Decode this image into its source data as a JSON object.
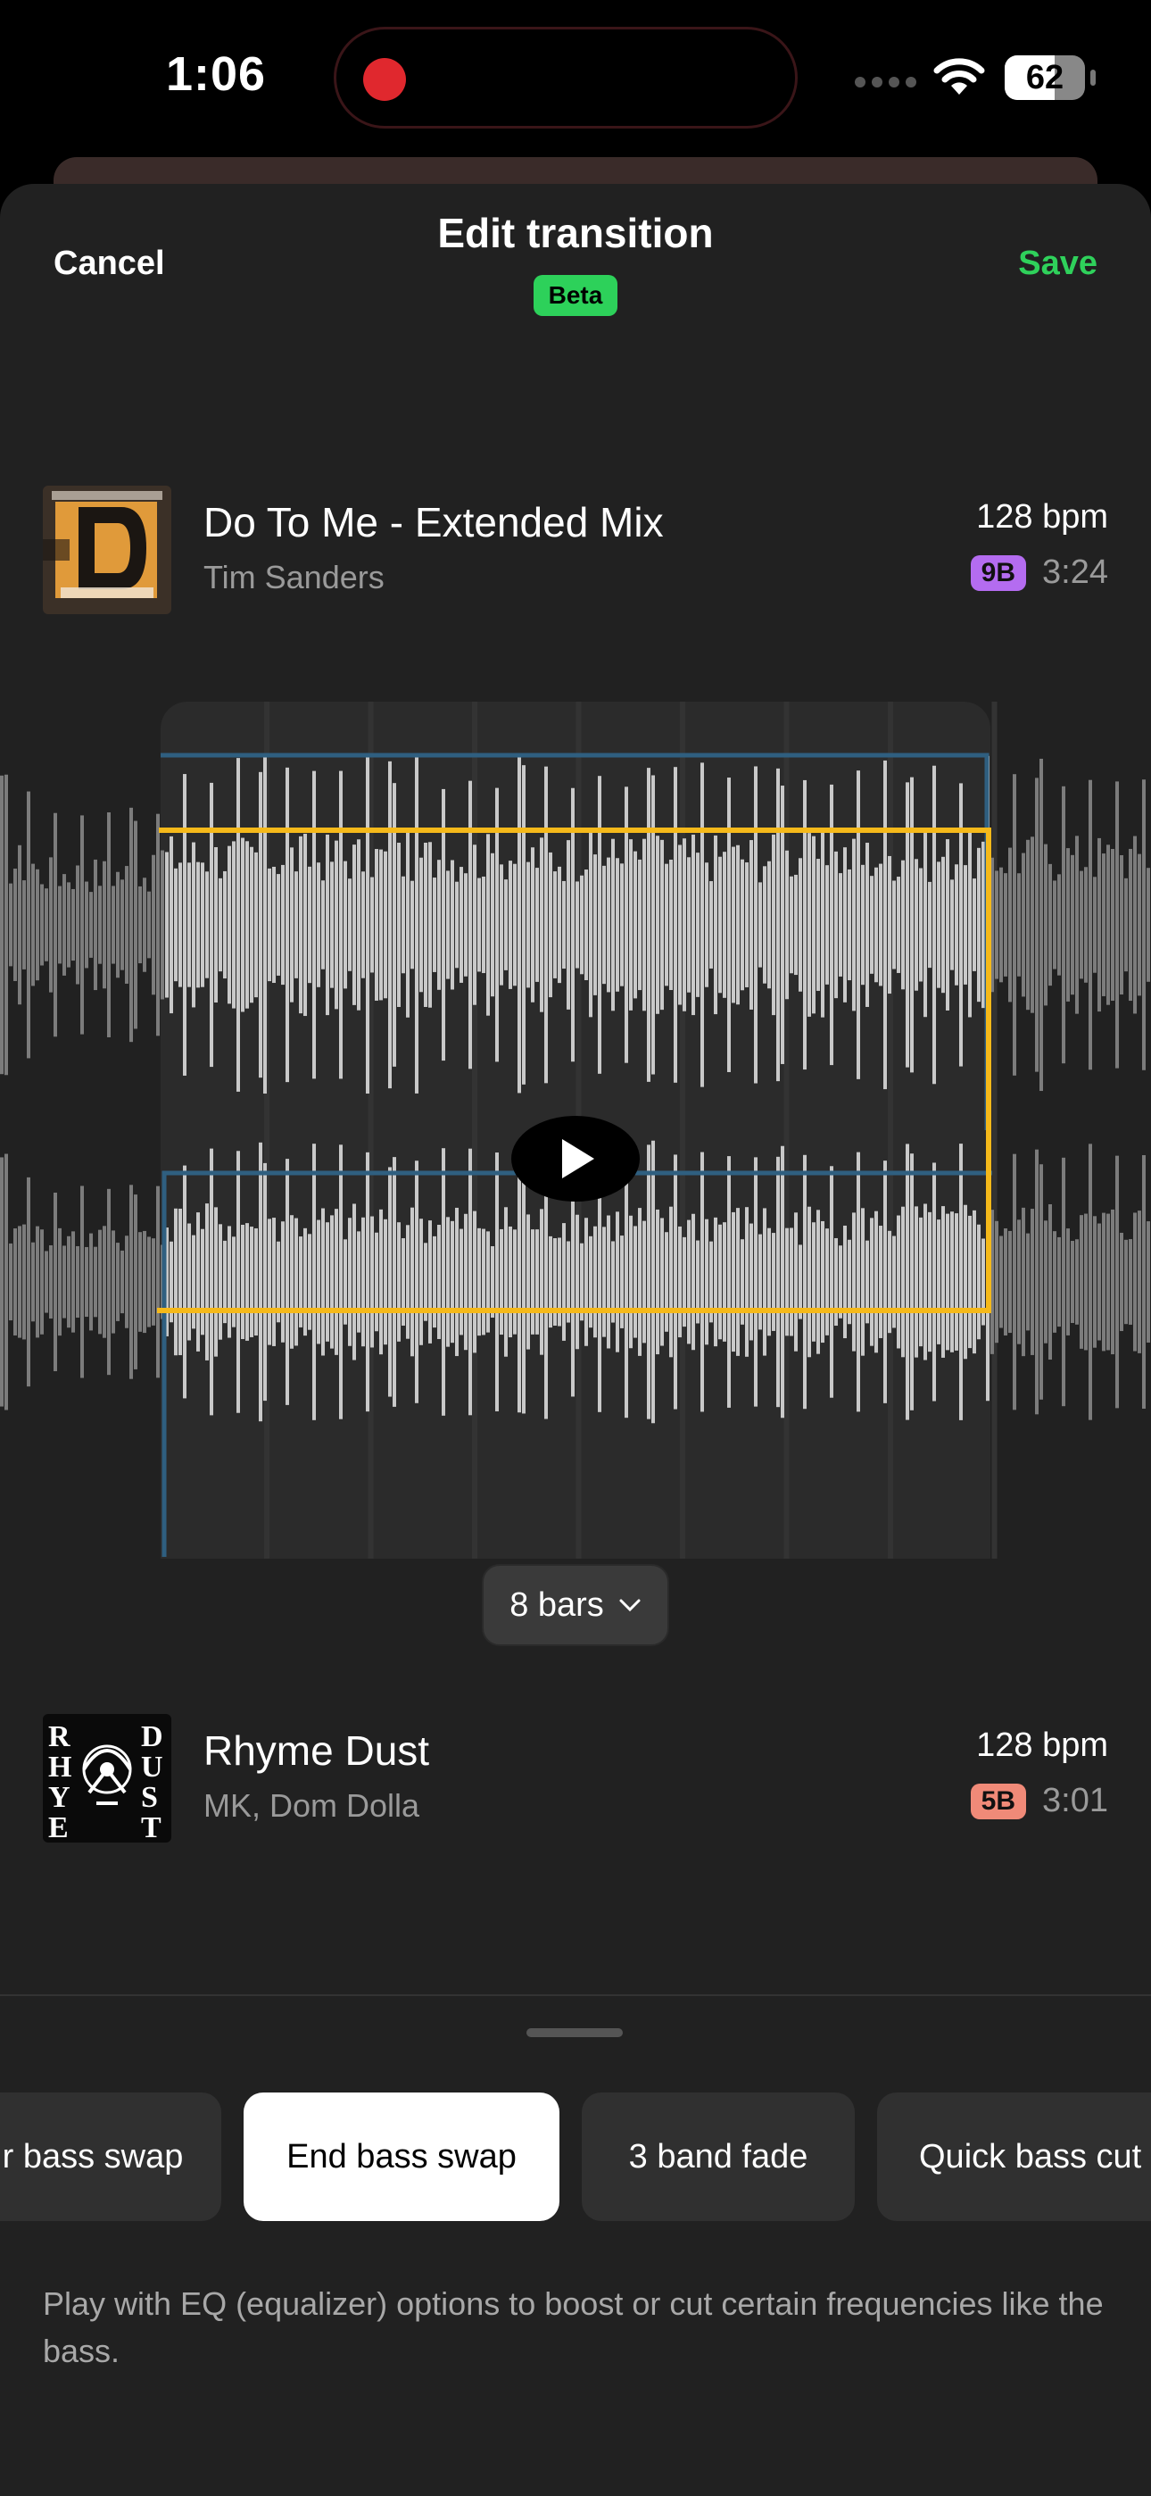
{
  "status": {
    "time": "1:06",
    "battery": "62",
    "battery_level": 0.62
  },
  "header": {
    "cancel": "Cancel",
    "title": "Edit transition",
    "badge": "Beta",
    "save": "Save"
  },
  "track_a": {
    "title": "Do To Me - Extended Mix",
    "artist": "Tim Sanders",
    "bpm": "128 bpm",
    "key": "9B",
    "key_color": "#b46cf0",
    "duration": "3:24"
  },
  "track_b": {
    "title": "Rhyme Dust",
    "artist": "MK, Dom Dolla",
    "bpm": "128 bpm",
    "key": "5B",
    "key_color": "#f08a78",
    "duration": "3:01"
  },
  "transition": {
    "length": "8 bars"
  },
  "options": [
    "r bass swap",
    "End bass swap",
    "3 band fade",
    "Quick bass cut"
  ],
  "selected_option": "End bass swap",
  "description": "Play with EQ (equalizer) options to boost or cut certain frequencies like the bass.",
  "colors": {
    "accent": "#2fd15b",
    "curve": "#f5b91a",
    "guide": "#2f5f80",
    "record": "#e0282e"
  }
}
